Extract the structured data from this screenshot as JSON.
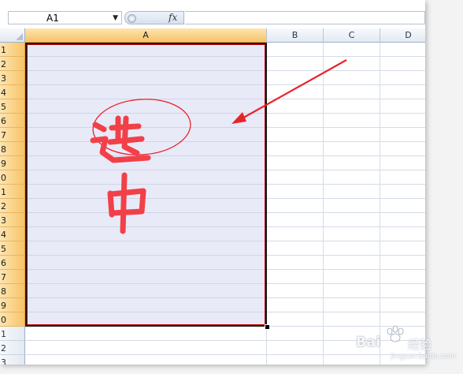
{
  "formula_bar": {
    "name_box_value": "A1",
    "fx_label": "fx",
    "formula_value": ""
  },
  "columns": [
    {
      "label": "A",
      "selected": true
    },
    {
      "label": "B",
      "selected": false
    },
    {
      "label": "C",
      "selected": false
    },
    {
      "label": "D",
      "selected": false
    }
  ],
  "rows": [
    {
      "label": "1",
      "selected": true
    },
    {
      "label": "2",
      "selected": true
    },
    {
      "label": "3",
      "selected": true
    },
    {
      "label": "4",
      "selected": true
    },
    {
      "label": "5",
      "selected": true
    },
    {
      "label": "6",
      "selected": true
    },
    {
      "label": "7",
      "selected": true
    },
    {
      "label": "8",
      "selected": true
    },
    {
      "label": "9",
      "selected": true
    },
    {
      "label": "0",
      "selected": true
    },
    {
      "label": "1",
      "selected": true
    },
    {
      "label": "2",
      "selected": true
    },
    {
      "label": "3",
      "selected": true
    },
    {
      "label": "4",
      "selected": true
    },
    {
      "label": "5",
      "selected": true
    },
    {
      "label": "6",
      "selected": true
    },
    {
      "label": "7",
      "selected": true
    },
    {
      "label": "8",
      "selected": true
    },
    {
      "label": "9",
      "selected": true
    },
    {
      "label": "0",
      "selected": true
    },
    {
      "label": "1",
      "selected": false
    },
    {
      "label": "2",
      "selected": false
    },
    {
      "label": "3",
      "selected": false
    }
  ],
  "annotation": {
    "handwritten_text": "选中",
    "color": "#e8242a"
  },
  "watermark": {
    "brand": "Bai",
    "brand_suffix": "经验",
    "sub": "jingyan.baidu.com"
  },
  "colors": {
    "selection_header": "#f7c467",
    "header_bg": "#e3e9f2",
    "grid_line": "#d4dbe6",
    "selection_border": "#c00000"
  }
}
